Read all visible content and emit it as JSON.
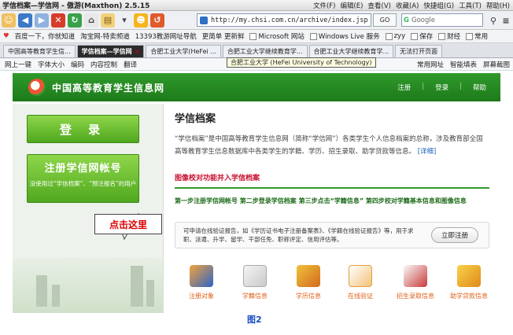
{
  "window": {
    "title": "学信档案—学信网 - 傲游(Maxthon) 2.5.15",
    "menu": [
      "文件(F)",
      "编辑(E)",
      "查看(V)",
      "收藏(A)",
      "快捷组(G)",
      "工具(T)",
      "帮助(H)"
    ]
  },
  "toolbar": {
    "address": "http://my.chsi.com.cn/archive/index.jsp",
    "go_label": "GO",
    "search_placeholder": "Google"
  },
  "favorites": [
    "百度一下，你就知道",
    "淘宝网-特卖频道",
    "13393教游网址导航",
    "更简单 更新鲜",
    "Microsoft 网站",
    "Windows Live 服务",
    "zyy",
    "保存",
    "财经",
    "常用"
  ],
  "tabs": [
    {
      "label": "中国高等教育学生信..."
    },
    {
      "label": "学信档案—学信网"
    },
    {
      "label": "合肥工业大学(HeFei ..."
    },
    {
      "label": "合肥工业大学继续教育学..."
    },
    {
      "label": "合肥工业大学继续教育学..."
    },
    {
      "label": "无法打开页面"
    }
  ],
  "tab_tooltip": "合肥工业大学 (HeFei University of Technology)",
  "subbar": {
    "items": [
      "网上一键",
      "字体大小",
      "编码",
      "内容控制",
      "翻译"
    ],
    "right": [
      "常用网址",
      "智能填表",
      "屏幕截图"
    ]
  },
  "site": {
    "title": "中国高等教育学生信息网",
    "nav": [
      "注册",
      "登录",
      "帮助"
    ]
  },
  "left": {
    "login": "登 录",
    "register": "注册学信网帐号",
    "register_hint": "没使用过“学信档案”、“预注报名”的用户",
    "callout": "点击这里"
  },
  "main": {
    "heading": "学信档案",
    "desc": "“学信档案”是中国高等教育学生信息网（简称“学信网”）各类学生个人信息档案的总称，涉及教育部全国高等教育学生信息数据库中各类学生的学籍、学历、招生录取、助学贷款等信息。",
    "desc_link": "[详细]",
    "notice": "图像校对功能并入学信档案",
    "steps": "第一步注册学信网帐号  第二步登录学信档案  第三步点击“学籍信息”  第四步校对学籍基本信息和图像信息",
    "verify_text": "可申请在线验证报告，如《学历证书电子注册备案表》、《学籍在线验证报告》等，用于求职、派遣、升学、留学、干部任免、职称评定、信用评估等。",
    "verify_button": "立即注册",
    "icons": [
      "注册对象",
      "学籍信息",
      "学历信息",
      "在线验证",
      "招生录取信息",
      "助学贷款信息"
    ]
  },
  "figure_label": "图2"
}
